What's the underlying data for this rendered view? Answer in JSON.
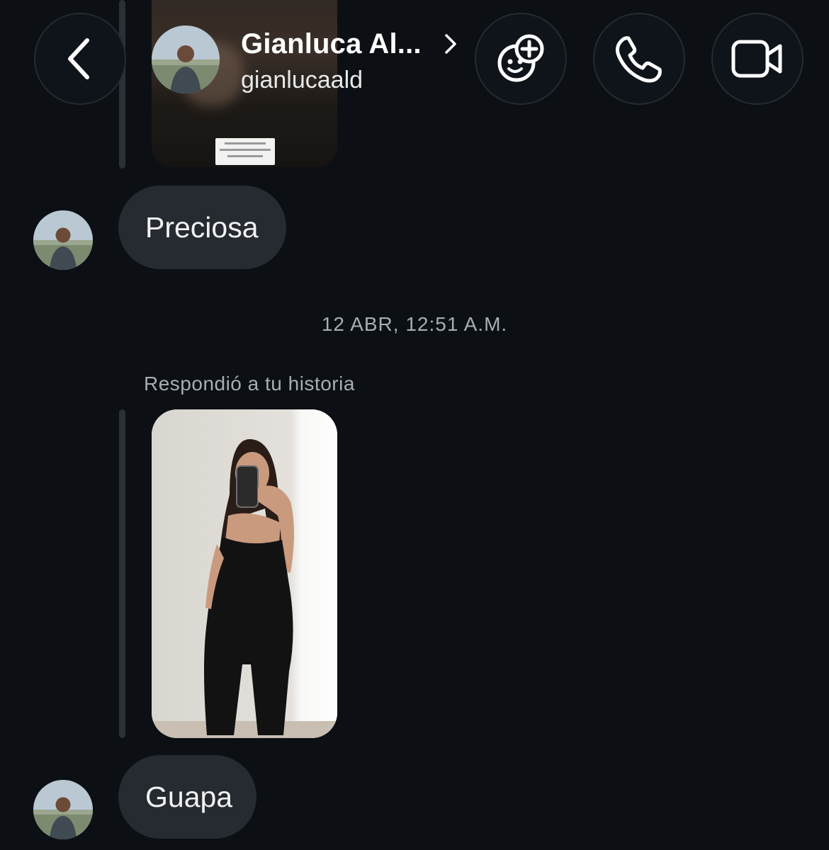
{
  "header": {
    "name": "Gianluca Al...",
    "username": "gianlucaald",
    "icons": {
      "back": "chevron-left-icon",
      "profile_chevron": "chevron-right-icon",
      "effects": "effects-face-plus-icon",
      "call": "phone-icon",
      "video": "video-camera-icon"
    }
  },
  "messages": [
    {
      "text": "Preciosa"
    },
    {
      "timestamp": "12 ABR, 12:51 A.M."
    },
    {
      "reply_label": "Respondió a tu historia"
    },
    {
      "text": "Guapa"
    }
  ],
  "colors": {
    "background": "#0c1014",
    "bubble": "#262b31",
    "muted_text": "#a8adb3"
  }
}
